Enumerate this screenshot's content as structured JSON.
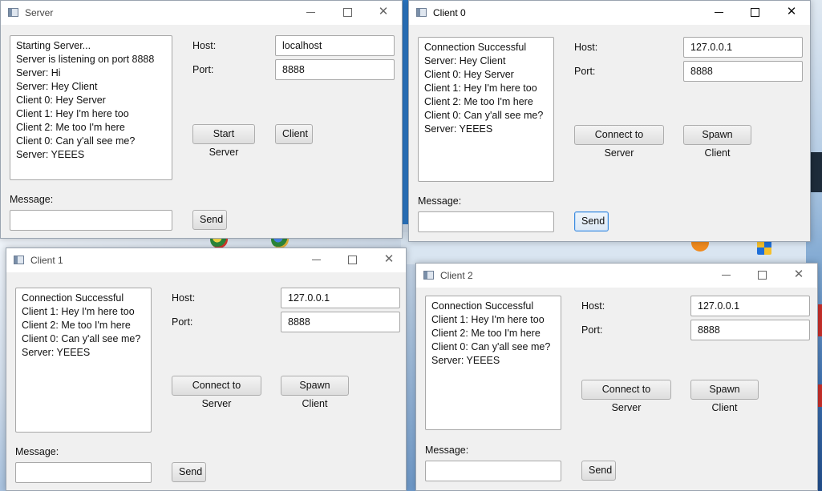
{
  "windows": {
    "server": {
      "title": "Server",
      "log": [
        "Starting Server...",
        "Server is listening on port 8888",
        "Server: Hi",
        "Server: Hey Client",
        "Client 0: Hey Server",
        "Client 1: Hey I'm here too",
        "Client 2: Me too I'm here",
        "Client 0: Can y'all see me?",
        "Server: YEEES"
      ],
      "host_label": "Host:",
      "host_value": "localhost",
      "port_label": "Port:",
      "port_value": "8888",
      "primary_button": "Start Server",
      "secondary_button": "Client",
      "message_label": "Message:",
      "message_value": "",
      "send_label": "Send"
    },
    "client0": {
      "title": "Client 0",
      "log": [
        "Connection Successful",
        "Server: Hey Client",
        "Client 0: Hey Server",
        "Client 1: Hey I'm here too",
        "Client 2: Me too I'm here",
        "Client 0: Can y'all see me?",
        "Server: YEEES"
      ],
      "host_label": "Host:",
      "host_value": "127.0.0.1",
      "port_label": "Port:",
      "port_value": "8888",
      "primary_button": "Connect to Server",
      "secondary_button": "Spawn Client",
      "message_label": "Message:",
      "message_value": "",
      "send_label": "Send"
    },
    "client1": {
      "title": "Client 1",
      "log": [
        "Connection Successful",
        "Client 1: Hey I'm here too",
        "Client 2: Me too I'm here",
        "Client 0: Can y'all see me?",
        "Server: YEEES"
      ],
      "host_label": "Host:",
      "host_value": "127.0.0.1",
      "port_label": "Port:",
      "port_value": "8888",
      "primary_button": "Connect to Server",
      "secondary_button": "Spawn Client",
      "message_label": "Message:",
      "message_value": "",
      "send_label": "Send"
    },
    "client2": {
      "title": "Client 2",
      "log": [
        "Connection Successful",
        "Client 1: Hey I'm here too",
        "Client 2: Me too I'm here",
        "Client 0: Can y'all see me?",
        "Server: YEEES"
      ],
      "host_label": "Host:",
      "host_value": "127.0.0.1",
      "port_label": "Port:",
      "port_value": "8888",
      "primary_button": "Connect to Server",
      "secondary_button": "Spawn Client",
      "message_label": "Message:",
      "message_value": "",
      "send_label": "Send"
    }
  },
  "colors": {
    "focus_border": "#3c8be0",
    "window_bg": "#f0f0f0",
    "titlebar_bg": "#ffffff"
  },
  "icons": {
    "window_controls": [
      "minimize-icon",
      "maximize-icon",
      "close-icon"
    ],
    "title_icon": "java-window-icon"
  }
}
